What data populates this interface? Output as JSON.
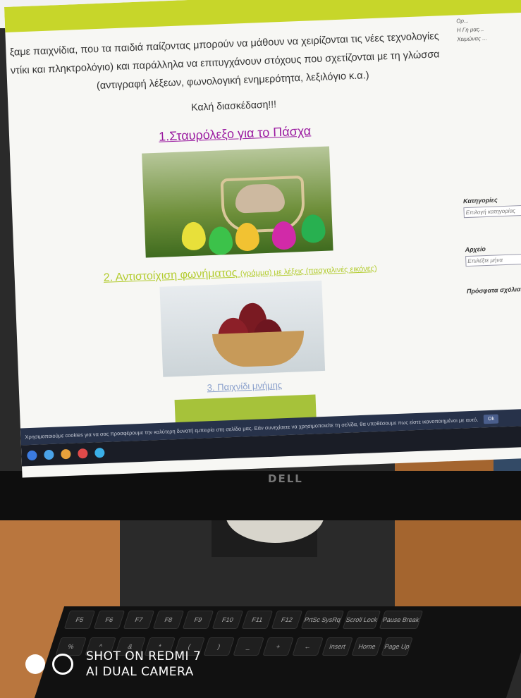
{
  "page": {
    "intro_line1": "ξαμε παιχνίδια, που τα παιδιά παίζοντας μπορούν να μάθουν να χειρίζονται τις νέες τεχνολογίες",
    "intro_line2": "ντίκι και πληκτρολόγιο) και παράλληλα να επιτυγχάνουν στόχους που σχετίζονται με τη γλώσσα",
    "intro_line3": "(αντιγραφή λέξεων, φωνολογική ενημερότητα, λεξιλόγιο κ.α.)",
    "greeting": "Καλή διασκέδαση!!!",
    "link1": "1.Σταυρόλεξο για το Πάσχα",
    "link2": "2. Αντιστοίχιση φωνήματος",
    "link2_suffix": "(γράμμα) με λέξεις (πασχαλινές εικόνες)",
    "link3": "3. Παιχνίδι μνήμης"
  },
  "sidebar": {
    "items": [
      "Ορ...",
      "Η Γη μας...",
      "Χειμώνας ..."
    ],
    "categories_label": "Κατηγορίες",
    "categories_select": "Επιλογή κατηγορίας",
    "archive_label": "Αρχείο",
    "archive_select": "Επιλέξτε μήνα",
    "recent_comments_label": "Πρόσφατα σχόλια"
  },
  "cookie_bar": {
    "text": "Χρησιμοποιούμε cookies για να σας προσφέρουμε την καλύτερη δυνατή εμπειρία στη σελίδα μας. Εάν συνεχίσετε να χρησιμοποιείτε τη σελίδα, θα υποθέσουμε πως είστε ικανοποιημένοι με αυτό.",
    "ok_label": "Ok"
  },
  "monitor": {
    "brand": "DELL"
  },
  "keyboard": {
    "row1": [
      "F5",
      "F6",
      "F7",
      "F8",
      "F9",
      "F10",
      "F11",
      "F12",
      "PrtSc SysRq",
      "Scroll Lock",
      "Pause Break"
    ],
    "row2": [
      "%",
      "^",
      "&",
      "*",
      "(",
      ")",
      "_",
      "+",
      "←",
      "Insert",
      "Home",
      "Page Up"
    ]
  },
  "watermark": {
    "line1": "SHOT ON REDMI 7",
    "line2": "AI DUAL CAMERA"
  }
}
